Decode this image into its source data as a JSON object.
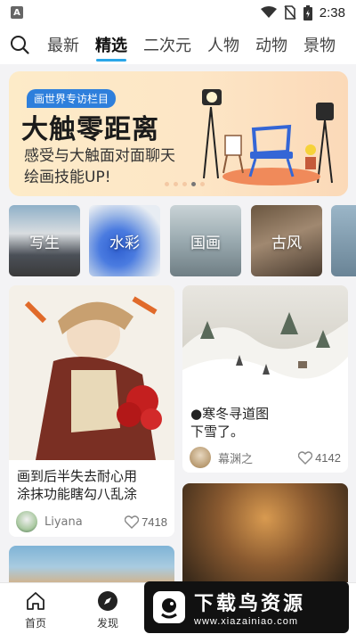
{
  "status_bar": {
    "app_icon_letter": "A",
    "time": "2:38"
  },
  "tabs": [
    {
      "label": "最新"
    },
    {
      "label": "精选"
    },
    {
      "label": "二次元"
    },
    {
      "label": "人物"
    },
    {
      "label": "动物"
    },
    {
      "label": "景物"
    }
  ],
  "active_tab": "精选",
  "banner": {
    "tag": "画世界专访栏目",
    "headline": "大触零距离",
    "subtitle_line1": "感受与大触面对面聊天",
    "subtitle_line2": "绘画技能UP!"
  },
  "categories": [
    {
      "label": "写生"
    },
    {
      "label": "水彩"
    },
    {
      "label": "国画"
    },
    {
      "label": "古风"
    }
  ],
  "feed": [
    {
      "title_line1": "画到后半失去耐心用",
      "title_line2": "涂抹功能瞎勾八乱涂",
      "author": "Liyana",
      "likes": "7418"
    },
    {
      "title_line1": "●寒冬寻道图",
      "title_line2": "下雪了。",
      "author": "幕渊之",
      "likes": "4142"
    }
  ],
  "bottom_nav": [
    {
      "label": "首页"
    },
    {
      "label": "发现"
    }
  ],
  "watermark": {
    "title": "下载鸟资源",
    "url": "www.xiazainiao.com"
  },
  "colors": {
    "accent": "#2aa6e8",
    "banner_tag": "#2e7fdc"
  }
}
